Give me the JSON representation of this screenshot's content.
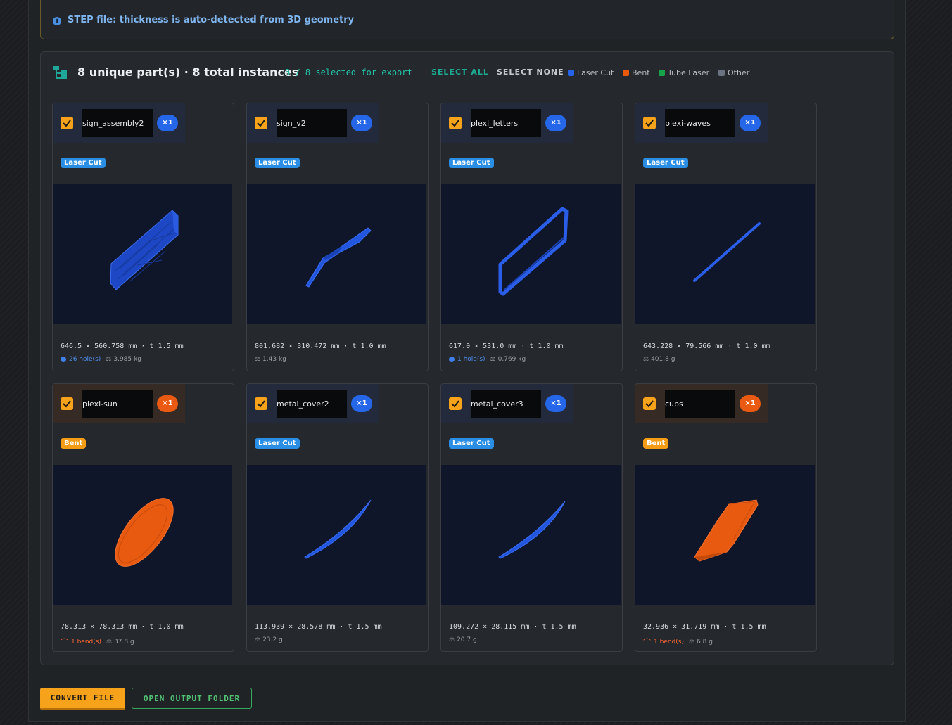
{
  "notice": {
    "text": "STEP file: thickness is auto-detected from 3D geometry",
    "icon": "info-icon"
  },
  "header": {
    "title": "8 unique part(s) · 8 total instances",
    "selected": "8 / 8 selected for export",
    "select_all": "SELECT ALL",
    "select_none": "SELECT NONE"
  },
  "legend": [
    {
      "label": "Laser Cut",
      "color": "#2563eb"
    },
    {
      "label": "Bent",
      "color": "#ea580c"
    },
    {
      "label": "Tube Laser",
      "color": "#16a34a"
    },
    {
      "label": "Other",
      "color": "#6b7280"
    }
  ],
  "parts": [
    {
      "name": "sign_assembly2",
      "qty": "×1",
      "type": "Laser Cut",
      "dims": "646.5 × 560.758 mm · t 1.5 mm",
      "holes": "26 hole(s)",
      "bends": "",
      "weight": "3.985 kg",
      "checked": true,
      "color": "#2563eb"
    },
    {
      "name": "sign_v2",
      "qty": "×1",
      "type": "Laser Cut",
      "dims": "801.682 × 310.472 mm · t 1.0 mm",
      "holes": "",
      "bends": "",
      "weight": "1.43 kg",
      "checked": true,
      "color": "#2563eb"
    },
    {
      "name": "plexi_letters",
      "qty": "×1",
      "type": "Laser Cut",
      "dims": "617.0 × 531.0 mm · t 1.0 mm",
      "holes": "1 hole(s)",
      "bends": "",
      "weight": "0.769 kg",
      "checked": true,
      "color": "#2563eb"
    },
    {
      "name": "plexi-waves",
      "qty": "×1",
      "type": "Laser Cut",
      "dims": "643.228 × 79.566 mm · t 1.0 mm",
      "holes": "",
      "bends": "",
      "weight": "401.8 g",
      "checked": true,
      "color": "#2563eb"
    },
    {
      "name": "plexi-sun",
      "qty": "×1",
      "type": "Bent",
      "dims": "78.313 × 78.313 mm · t 1.0 mm",
      "holes": "",
      "bends": "1 bend(s)",
      "weight": "37.8 g",
      "checked": true,
      "color": "#ea580c"
    },
    {
      "name": "metal_cover2",
      "qty": "×1",
      "type": "Laser Cut",
      "dims": "113.939 × 28.578 mm · t 1.5 mm",
      "holes": "",
      "bends": "",
      "weight": "23.2 g",
      "checked": true,
      "color": "#2563eb"
    },
    {
      "name": "metal_cover3",
      "qty": "×1",
      "type": "Laser Cut",
      "dims": "109.272 × 28.115 mm · t 1.5 mm",
      "holes": "",
      "bends": "",
      "weight": "20.7 g",
      "checked": true,
      "color": "#2563eb"
    },
    {
      "name": "cups",
      "qty": "×1",
      "type": "Bent",
      "dims": "32.936 × 31.719 mm · t 1.5 mm",
      "holes": "",
      "bends": "1 bend(s)",
      "weight": "6.8 g",
      "checked": true,
      "color": "#ea580c"
    }
  ],
  "actions": {
    "convert": "CONVERT FILE",
    "open_folder": "OPEN OUTPUT FOLDER"
  }
}
